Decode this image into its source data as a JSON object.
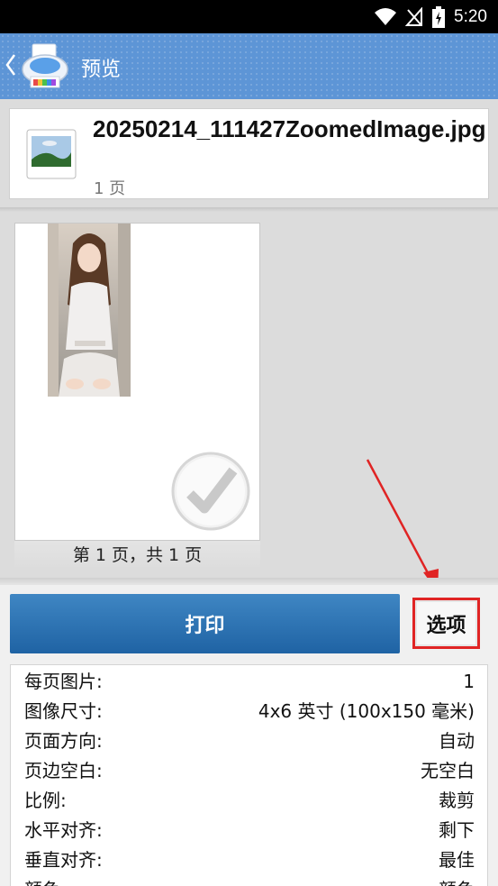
{
  "status_bar": {
    "time": "5:20",
    "icons": [
      "wifi-icon",
      "signal-off-icon",
      "battery-charging-icon"
    ]
  },
  "app_bar": {
    "title": "预览",
    "back_icon": "chevron-left-icon",
    "app_icon": "printer-icon"
  },
  "file": {
    "name": "20250214_111427ZoomedImage.jpg",
    "pages": "1 页",
    "icon": "image-file-icon"
  },
  "preview": {
    "caption": "第 1 页，共 1 页",
    "selected": true
  },
  "actions": {
    "print_label": "打印",
    "options_label": "选项"
  },
  "settings": [
    {
      "label": "每页图片:",
      "value": "1"
    },
    {
      "label": "图像尺寸:",
      "value": "4x6 英寸 (100x150 毫米)"
    },
    {
      "label": "页面方向:",
      "value": "自动"
    },
    {
      "label": "页边空白:",
      "value": "无空白"
    },
    {
      "label": "比例:",
      "value": "裁剪"
    },
    {
      "label": "水平对齐:",
      "value": "剩下"
    },
    {
      "label": "垂直对齐:",
      "value": "最佳"
    },
    {
      "label": "颜色",
      "value": "颜色"
    }
  ],
  "colors": {
    "app_bar": "#5d95d6",
    "print_button": "#2a73b3",
    "highlight": "#e02424"
  }
}
